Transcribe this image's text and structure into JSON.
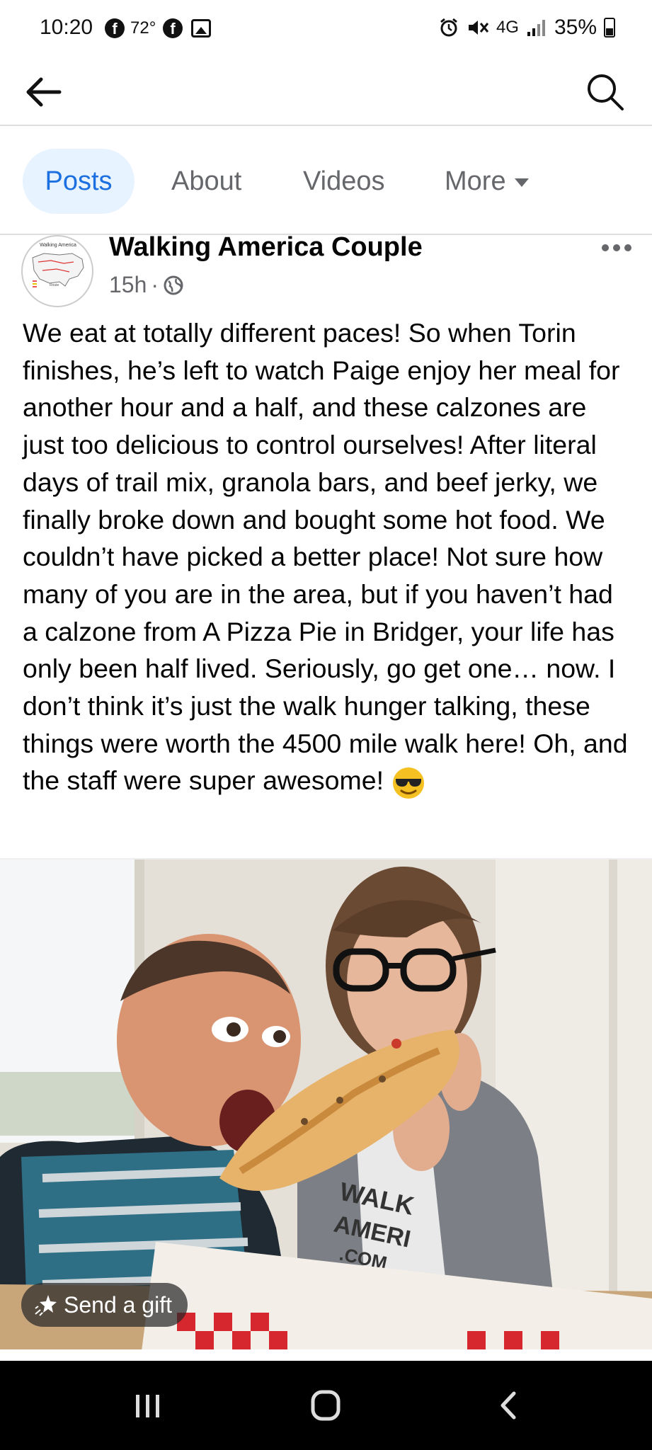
{
  "status_bar": {
    "time": "10:20",
    "temperature": "72°",
    "network": "4G",
    "battery": "35%"
  },
  "nav": {
    "back_icon": "arrow-left-icon",
    "search_icon": "search-icon"
  },
  "tabs": [
    {
      "label": "Posts",
      "active": true
    },
    {
      "label": "About",
      "active": false
    },
    {
      "label": "Videos",
      "active": false
    },
    {
      "label": "More",
      "active": false
    }
  ],
  "post": {
    "author": "Walking America Couple",
    "time": "15h",
    "separator": "·",
    "privacy_icon": "globe-icon",
    "avatar_text": "Walking America",
    "avatar_route": "Route",
    "text": "We eat at totally different paces! So when Torin finishes, he’s left to watch Paige enjoy her meal for another hour and a half, and these calzones are just too delicious to control ourselves! After literal days of trail mix, granola bars, and beef jerky, we finally broke down and bought some hot food. We couldn’t have picked a better place! Not sure how many of you are in the area, but if you haven’t had a calzone from A Pizza Pie in Bridger, your life has only been half lived. Seriously, go get one… now. I don’t think it’s just the walk hunger talking, these things were worth the 4500 mile walk here! Oh, and the staff were super awesome!",
    "emoji": "sunglasses-emoji",
    "shirt_text": [
      "WALK",
      "AMERI",
      ".COM"
    ]
  },
  "gift_button": {
    "label": "Send a gift"
  },
  "colors": {
    "accent": "#1b6fe0",
    "tab_active_bg": "#e7f3ff",
    "secondary_text": "#65676b"
  }
}
